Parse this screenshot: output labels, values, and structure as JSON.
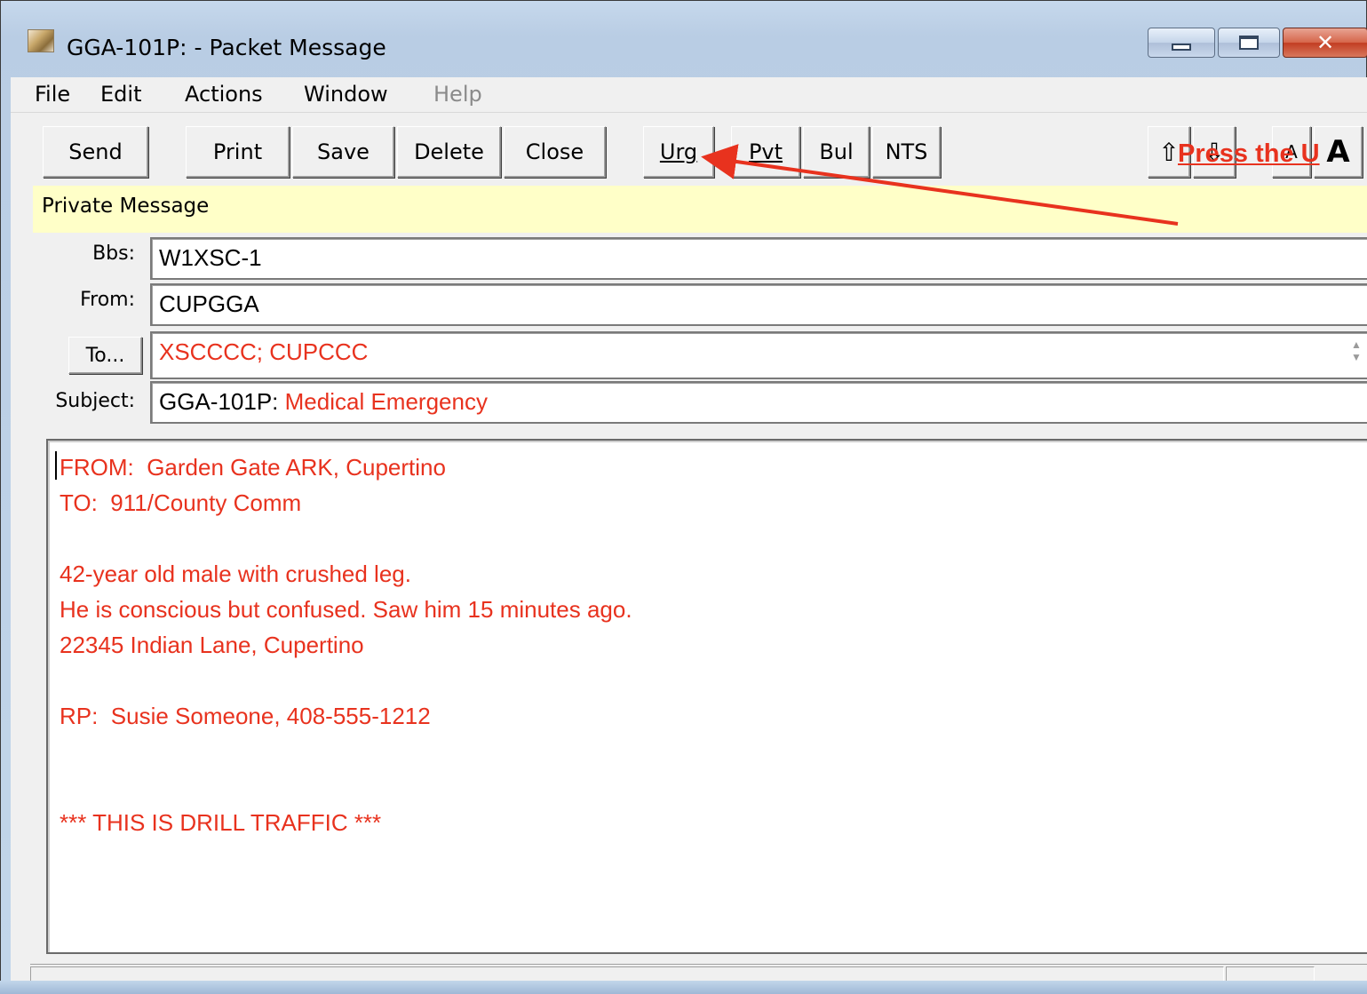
{
  "window": {
    "title": "GGA-101P:  - Packet Message",
    "controls": {
      "minimize": "minimize-icon",
      "maximize": "maximize-icon",
      "close": "✕"
    }
  },
  "menu": [
    "File",
    "Edit",
    "Actions",
    "Window",
    "Help"
  ],
  "toolbar": {
    "send": "Send",
    "print": "Print",
    "save": "Save",
    "delete": "Delete",
    "close": "Close",
    "urg": "Urg",
    "pvt": "Pvt",
    "bul": "Bul",
    "nts": "NTS",
    "up": "⇧",
    "down": "⇩",
    "font_small": "A",
    "font_large": "A"
  },
  "status_message": "Private Message",
  "annotation": "Press the U",
  "fields": {
    "bbs_label": "Bbs:",
    "bbs_value": "W1XSC-1",
    "from_label": "From:",
    "from_value": "CUPGGA",
    "to_button": "To...",
    "to_value": "XSCCCC; CUPCCC",
    "subject_label": "Subject:",
    "subject_prefix": "GGA-101P:",
    "subject_value": " Medical Emergency"
  },
  "body_lines": [
    "FROM:  Garden Gate ARK, Cupertino",
    "TO:  911/County Comm",
    "",
    "42-year old male with crushed leg.",
    "He is conscious but confused. Saw him 15 minutes ago.",
    "22345 Indian Lane, Cupertino",
    "",
    "RP:  Susie Someone, 408-555-1212",
    "",
    "",
    "*** THIS IS DRILL TRAFFIC ***"
  ],
  "colors": {
    "accent_red": "#e8321e",
    "status_yellow": "#ffffc8",
    "frame_blue": "#c2d6ea"
  }
}
